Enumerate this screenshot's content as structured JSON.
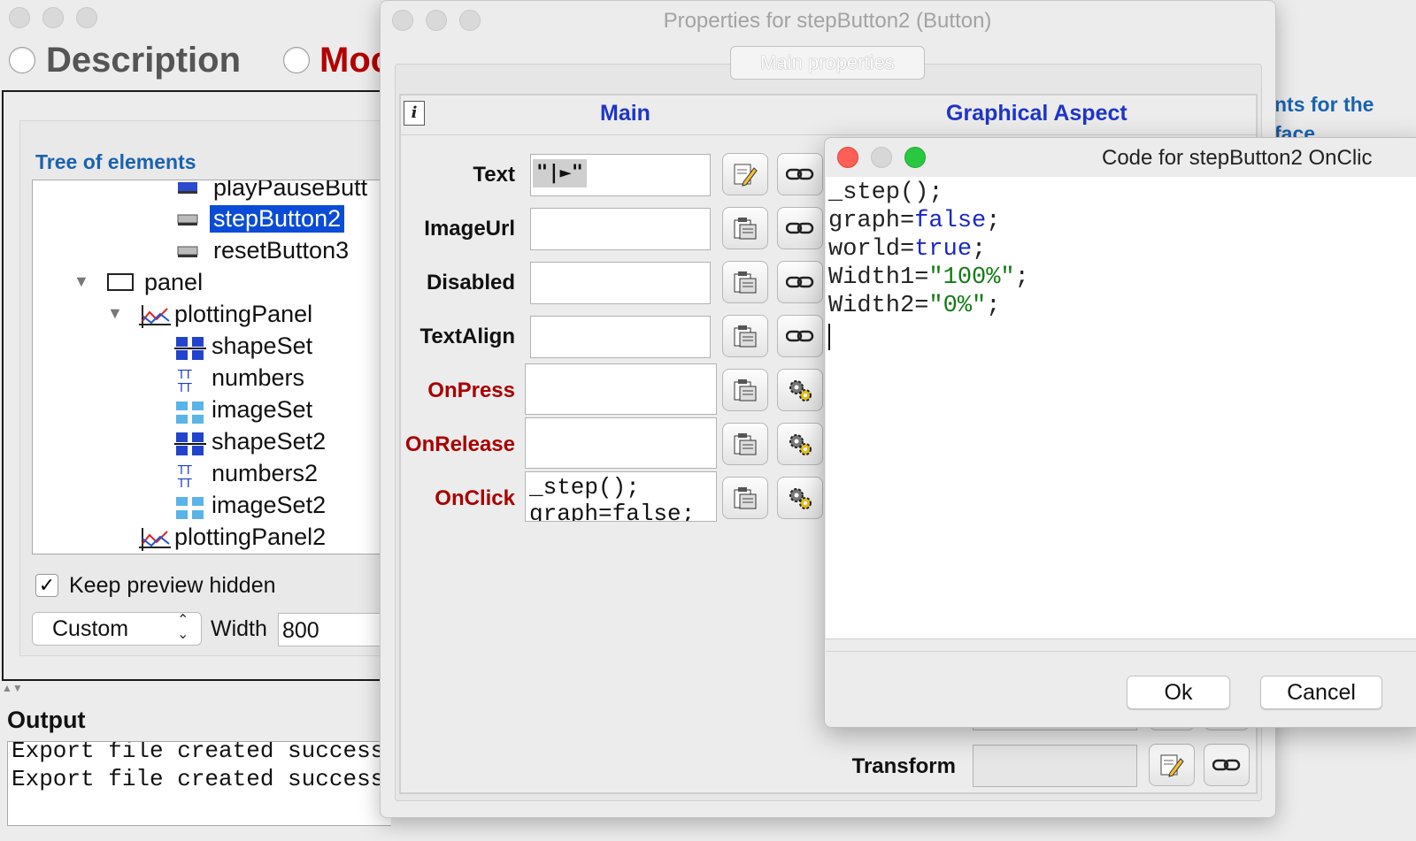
{
  "main_window": {
    "tabs": [
      {
        "label": "Description"
      },
      {
        "label": "Moc"
      }
    ],
    "tree_title": "Tree of elements",
    "tree_items": [
      {
        "label": "playPauseButt",
        "icon": "button-icon"
      },
      {
        "label": "stepButton2",
        "icon": "button-icon",
        "selected": true
      },
      {
        "label": "resetButton3",
        "icon": "button-icon"
      },
      {
        "label": "panel",
        "icon": "panel-icon"
      },
      {
        "label": "plottingPanel",
        "icon": "plotting-panel-icon"
      },
      {
        "label": "shapeSet",
        "icon": "shape-set-icon"
      },
      {
        "label": "numbers",
        "icon": "text-set-icon"
      },
      {
        "label": "imageSet",
        "icon": "image-set-icon"
      },
      {
        "label": "shapeSet2",
        "icon": "shape-set-icon"
      },
      {
        "label": "numbers2",
        "icon": "text-set-icon"
      },
      {
        "label": "imageSet2",
        "icon": "image-set-icon"
      },
      {
        "label": "plottingPanel2",
        "icon": "plotting-panel-icon"
      }
    ],
    "keep_preview_label": "Keep preview hidden",
    "keep_preview_checked": true,
    "size_select_value": "Custom",
    "width_label": "Width",
    "width_value": "800",
    "output_title": "Output",
    "output_lines": [
      "Export file created successf",
      "Export file created successf"
    ],
    "right_text_1": "nts for the",
    "right_text_2": "face"
  },
  "properties_dialog": {
    "title": "Properties for stepButton2 (Button)",
    "tab_label": "Main properties",
    "header_main": "Main",
    "header_graphical": "Graphical Aspect",
    "info_icon_glyph": "i",
    "text_label": "Text",
    "text_value": "\"|►\"",
    "imageurl_label": "ImageUrl",
    "disabled_label": "Disabled",
    "textalign_label": "TextAlign",
    "onpress_label": "OnPress",
    "onrelease_label": "OnRelease",
    "onclick_label": "OnClick",
    "onclick_line_1": "_step();",
    "onclick_line_2": "graph=false;",
    "transform_label": "Transform"
  },
  "code_dialog": {
    "title": "Code for stepButton2 OnClic",
    "code": {
      "l1": "_step();",
      "l2_a": "graph=",
      "l2_b": "false",
      "l2_c": ";",
      "l3_a": "world=",
      "l3_b": "true",
      "l3_c": ";",
      "l4_a": "Width1=",
      "l4_b": "\"100%\"",
      "l4_c": ";",
      "l5_a": "Width2=",
      "l5_b": "\"0%\"",
      "l5_c": ";"
    },
    "ok_label": "Ok",
    "cancel_label": "Cancel"
  },
  "colors": {
    "selection": "#0b4cd6",
    "section_title": "#1a62b0",
    "header_blue": "#1e35c8",
    "action_red": "#a80000",
    "keyword_blue": "#1a28c0",
    "string_green": "#137a13"
  }
}
